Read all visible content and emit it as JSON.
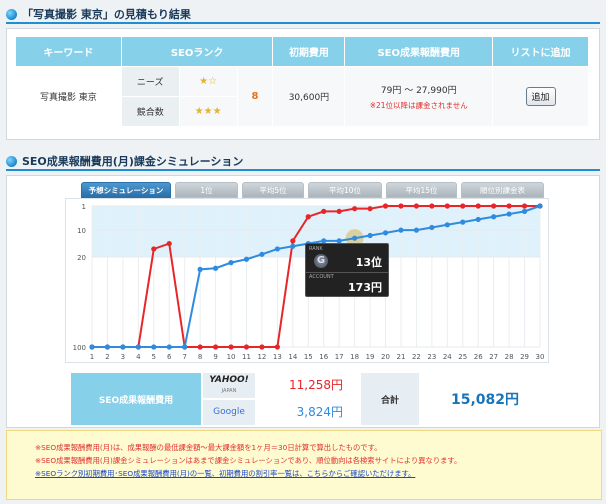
{
  "section1": {
    "title": "「写真撮影 東京」の見積もり結果"
  },
  "estimate": {
    "headers": [
      "キーワード",
      "SEOランク",
      "初期費用",
      "SEO成果報酬費用",
      "リストに追加"
    ],
    "keyword": "写真撮影 東京",
    "needs_label": "ニーズ",
    "needs_stars": "★☆",
    "competition_label": "競合数",
    "competition_stars": "★★★",
    "rank": "8",
    "initial_cost": "30,600円",
    "reward_range": "79円 ～ 27,990円",
    "reward_note": "※21位以降は課金されません",
    "add_label": "追加"
  },
  "section2": {
    "title": "SEO成果報酬費用(月)課金シミュレーション"
  },
  "tabs": [
    "予想シミュレーション",
    "1位",
    "平均5位",
    "平均10位",
    "平均15位",
    "順位別課金表"
  ],
  "tooltip": {
    "rank_label": "RANK",
    "rank": "13位",
    "account_label": "ACCOUNT",
    "amount": "173円"
  },
  "chart_data": {
    "type": "line",
    "x": [
      1,
      2,
      3,
      4,
      5,
      6,
      7,
      8,
      9,
      10,
      11,
      12,
      13,
      14,
      15,
      16,
      17,
      18,
      19,
      20,
      21,
      22,
      23,
      24,
      25,
      26,
      27,
      28,
      29,
      30
    ],
    "ytick_labels": [
      "1",
      "10",
      "20",
      "100"
    ],
    "series": [
      {
        "color": "#e8262a",
        "values": [
          100,
          100,
          100,
          100,
          17,
          15,
          100,
          100,
          100,
          100,
          100,
          100,
          100,
          14,
          5,
          3,
          3,
          2,
          2,
          1,
          1,
          1,
          1,
          1,
          1,
          1,
          1,
          1,
          1,
          1
        ]
      },
      {
        "color": "#2f8be0",
        "values": [
          100,
          100,
          100,
          100,
          100,
          100,
          100,
          31,
          30,
          25,
          22,
          19,
          17,
          16,
          15,
          14,
          14,
          13,
          12,
          11,
          10,
          10,
          9,
          8,
          7,
          6,
          5,
          4,
          3,
          1
        ]
      }
    ]
  },
  "summary": {
    "label": "SEO成果報酬費用",
    "yahoo_logo": "YAHOO!",
    "yahoo_sub": "JAPAN",
    "yahoo_amount": "11,258円",
    "google_logo": "Google",
    "google_amount": "3,824円",
    "total_label": "合計",
    "total_amount": "15,082円"
  },
  "notes": {
    "line1": "※SEO成果報酬費用(月)は、成果報酬の最低課金額～最大課金額を1ヶ月＝30日計算で算出したものです。",
    "line2": "※SEO成果報酬費用(月)課金シミュレーションはあまで課金シミュレーションであり、順位動向は各検索サイトにより異なります。",
    "line3": "※SEOランク別初期費用･SEO成果報酬費用(月)の一覧、初期費用の割引率一覧は、こちらからご確認いただけます。"
  },
  "colors": {
    "accent": "#1f8fd0",
    "header": "#87d0ea",
    "red": "#e8262a",
    "blue": "#2f8be0"
  }
}
